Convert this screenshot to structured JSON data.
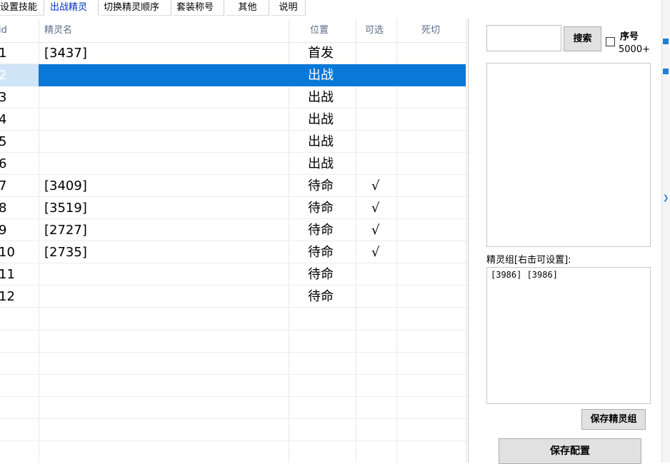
{
  "tabs": [
    {
      "label": "设置技能"
    },
    {
      "label": "出战精灵"
    },
    {
      "label": "切换精灵顺序"
    },
    {
      "label": "套装称号"
    },
    {
      "label": "其他"
    },
    {
      "label": "说明"
    }
  ],
  "grid": {
    "columns": [
      "id",
      "精灵名",
      "位置",
      "可选",
      "死切"
    ],
    "rows": [
      {
        "id": "1",
        "name": "[3437]",
        "position": "首发",
        "selectable": "",
        "death_switch": ""
      },
      {
        "id": "2",
        "name": "",
        "position": "出战",
        "selectable": "",
        "death_switch": ""
      },
      {
        "id": "3",
        "name": "",
        "position": "出战",
        "selectable": "",
        "death_switch": ""
      },
      {
        "id": "4",
        "name": "",
        "position": "出战",
        "selectable": "",
        "death_switch": ""
      },
      {
        "id": "5",
        "name": "",
        "position": "出战",
        "selectable": "",
        "death_switch": ""
      },
      {
        "id": "6",
        "name": "",
        "position": "出战",
        "selectable": "",
        "death_switch": ""
      },
      {
        "id": "7",
        "name": "[3409]",
        "position": "待命",
        "selectable": "√",
        "death_switch": ""
      },
      {
        "id": "8",
        "name": "[3519]",
        "position": "待命",
        "selectable": "√",
        "death_switch": ""
      },
      {
        "id": "9",
        "name": "[2727]",
        "position": "待命",
        "selectable": "√",
        "death_switch": ""
      },
      {
        "id": "10",
        "name": "[2735]",
        "position": "待命",
        "selectable": "√",
        "death_switch": ""
      },
      {
        "id": "11",
        "name": "",
        "position": "待命",
        "selectable": "",
        "death_switch": ""
      },
      {
        "id": "12",
        "name": "",
        "position": "待命",
        "selectable": "",
        "death_switch": ""
      }
    ],
    "selected_row_id": "2"
  },
  "search": {
    "value": "",
    "button_label": "搜索"
  },
  "checkbox": {
    "label_line1": "序号",
    "label_line2": "5000+",
    "checked": false
  },
  "group": {
    "label": "精灵组[右击可设置]:",
    "content": "[3986] [3986]"
  },
  "buttons": {
    "save_group": "保存精灵组",
    "save_config": "保存配置"
  },
  "colors": {
    "selection": "#0a78d7",
    "active_tab": "#0033cc",
    "header_text": "#5b6e8a"
  }
}
